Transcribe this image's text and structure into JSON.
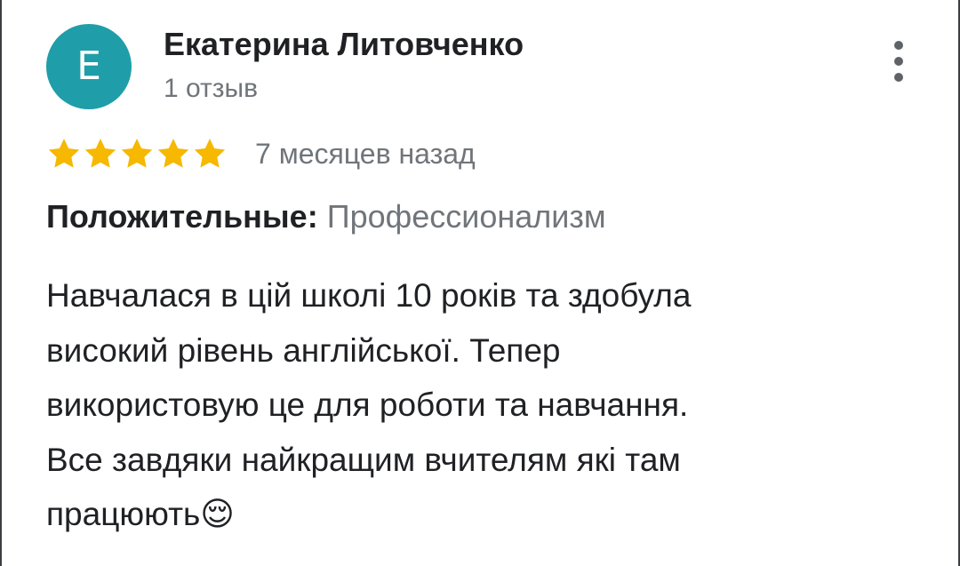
{
  "author": {
    "initial": "E",
    "name": "Екатерина Литовченко",
    "review_count": "1 отзыв"
  },
  "rating": {
    "stars": 5,
    "max_stars": 5,
    "date": "7 месяцев назад"
  },
  "highlights": {
    "label": "Положительные:",
    "value": "Профессионализм"
  },
  "review": {
    "text": "Навчалася в цій школі 10 років та здобула\nвисокий рівень англійської. Тепер\nвикористовую це для роботи та навчання.\nВсе завдяки найкращим вчителям які там\nпрацюють😌"
  },
  "colors": {
    "avatar": "#1f9ea9",
    "star": "#f6b801",
    "secondary_text": "#70757a"
  },
  "icons": {
    "star": "star-icon",
    "more": "more-vertical-icon"
  }
}
